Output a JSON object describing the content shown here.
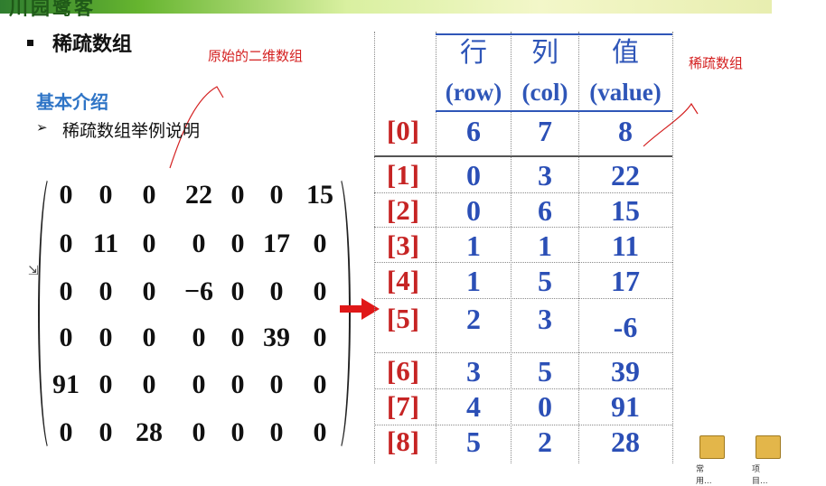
{
  "banner": {
    "logo_text": "川园鹭客"
  },
  "page_title": "稀疏数组",
  "annotations": {
    "original_label": "原始的二维数组",
    "sparse_label": "稀疏数组"
  },
  "section": {
    "subtitle": "基本介绍",
    "list_marker": "➢",
    "list_item": "稀疏数组举例说明"
  },
  "matrix": {
    "rows": [
      [
        "0",
        "0",
        "0",
        "22",
        "0",
        "0",
        "15"
      ],
      [
        "0",
        "11",
        "0",
        "0",
        "0",
        "17",
        "0"
      ],
      [
        "0",
        "0",
        "0",
        "−6",
        "0",
        "0",
        "0"
      ],
      [
        "0",
        "0",
        "0",
        "0",
        "0",
        "39",
        "0"
      ],
      [
        "91",
        "0",
        "0",
        "0",
        "0",
        "0",
        "0"
      ],
      [
        "0",
        "0",
        "28",
        "0",
        "0",
        "0",
        "0"
      ]
    ]
  },
  "sparse_table": {
    "headers": [
      {
        "cn": "行",
        "en": "(row)"
      },
      {
        "cn": "列",
        "en": "(col)"
      },
      {
        "cn": "值",
        "en": "(value)"
      }
    ],
    "rows": [
      {
        "index": "[0]",
        "row": "6",
        "col": "7",
        "value": "8"
      },
      {
        "index": "[1]",
        "row": "0",
        "col": "3",
        "value": "22"
      },
      {
        "index": "[2]",
        "row": "0",
        "col": "6",
        "value": "15"
      },
      {
        "index": "[3]",
        "row": "1",
        "col": "1",
        "value": "11"
      },
      {
        "index": "[4]",
        "row": "1",
        "col": "5",
        "value": "17"
      },
      {
        "index": "[5]",
        "row": "2",
        "col": "3",
        "value": "-6"
      },
      {
        "index": "[6]",
        "row": "3",
        "col": "5",
        "value": "39"
      },
      {
        "index": "[7]",
        "row": "4",
        "col": "0",
        "value": "91"
      },
      {
        "index": "[8]",
        "row": "5",
        "col": "2",
        "value": "28"
      }
    ]
  },
  "desktop_icons": [
    {
      "name": "folder-icon",
      "label": "常用..."
    },
    {
      "name": "folder-icon",
      "label": "项目..."
    }
  ],
  "colors": {
    "index_red": "#c62424",
    "value_blue": "#2b4fb6",
    "subtitle_blue": "#2e74c6",
    "annotation_red": "#d42020"
  }
}
